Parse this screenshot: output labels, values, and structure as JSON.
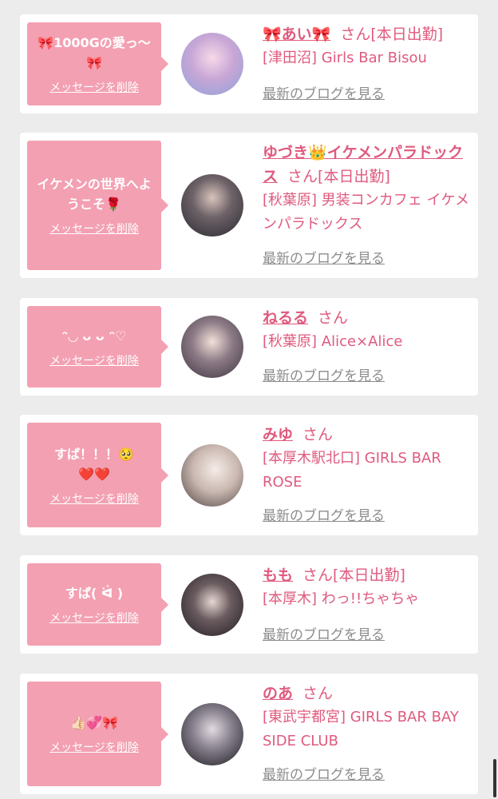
{
  "cards": [
    {
      "message": "🎀1000Gの愛っ〜🎀",
      "delete_label": "メッセージを削除",
      "name": "🎀あい🎀",
      "san": "さん",
      "status": "[本日出勤]",
      "shop": "[津田沼] Girls Bar Bisou",
      "blog": "最新のブログを見る"
    },
    {
      "message": "イケメンの世界へようこそ🌹",
      "delete_label": "メッセージを削除",
      "name": "ゆづき👑イケメンパラドックス",
      "san": "さん",
      "status": "[本日出勤]",
      "shop": "[秋葉原] 男装コンカフェ イケメンパラドックス",
      "blog": "最新のブログを見る"
    },
    {
      "message": "ᵔ◡ ᴗ ᴗ ᵔ♡",
      "delete_label": "メッセージを削除",
      "name": "ねるる",
      "san": "さん",
      "status": "",
      "shop": "[秋葉原] Alice×Alice",
      "blog": "最新のブログを見る"
    },
    {
      "message": "すぱ！！！🥺❤️❤️",
      "delete_label": "メッセージを削除",
      "name": "みゆ",
      "san": "さん",
      "status": "",
      "shop": "[本厚木駅北口] GIRLS BAR ROSE",
      "blog": "最新のブログを見る"
    },
    {
      "message": "すぱ( ᐛ )",
      "delete_label": "メッセージを削除",
      "name": "もも",
      "san": "さん",
      "status": "[本日出勤]",
      "shop": "[本厚木] わっ!!ちゃちゃ",
      "blog": "最新のブログを見る"
    },
    {
      "message": "👍🏻💞🎀",
      "delete_label": "メッセージを削除",
      "name": "のあ",
      "san": "さん",
      "status": "",
      "shop": "[東武宇都宮] GIRLS BAR BAY SIDE CLUB",
      "blog": "最新のブログを見る"
    }
  ],
  "colors": {
    "accent": "#e05a7e",
    "bubble": "#f3a0b2",
    "link_gray": "#8c8c8c",
    "background": "#ececec"
  }
}
